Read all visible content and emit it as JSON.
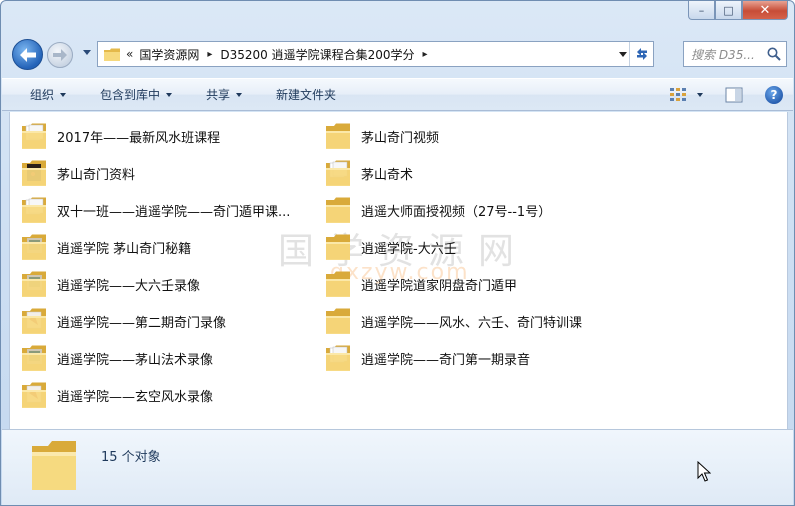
{
  "window": {
    "buttons": {
      "minimize": "–",
      "maximize": "□",
      "close": "✕"
    }
  },
  "address": {
    "overflow": "«",
    "crumbs": [
      "国学资源网",
      "D35200 逍遥学院课程合集200学分"
    ],
    "separator": "▸"
  },
  "search": {
    "placeholder": "搜索 D35..."
  },
  "toolbar": {
    "organize": "组织",
    "include_in_library": "包含到库中",
    "share": "共享",
    "new_folder": "新建文件夹"
  },
  "files": {
    "left": [
      {
        "name": "2017年——最新风水班课程",
        "icon": "folder-docs-icon"
      },
      {
        "name": "茅山奇门资料",
        "icon": "folder-dark-image-icon"
      },
      {
        "name": "双十一班——逍遥学院——奇门遁甲课...",
        "icon": "folder-docs-icon"
      },
      {
        "name": "逍遥学院 茅山奇门秘籍",
        "icon": "folder-image-icon"
      },
      {
        "name": "逍遥学院——大六壬录像",
        "icon": "folder-image-icon"
      },
      {
        "name": "逍遥学院——第二期奇门录像",
        "icon": "folder-red-icon"
      },
      {
        "name": "逍遥学院——茅山法术录像",
        "icon": "folder-image-icon"
      },
      {
        "name": "逍遥学院——玄空风水录像",
        "icon": "folder-red-icon"
      }
    ],
    "right": [
      {
        "name": "茅山奇门视频",
        "icon": "folder-icon"
      },
      {
        "name": "茅山奇术",
        "icon": "folder-docs-icon"
      },
      {
        "name": "逍遥大师面授视频（27号--1号）",
        "icon": "folder-icon"
      },
      {
        "name": "逍遥学院-大六壬",
        "icon": "folder-icon"
      },
      {
        "name": "逍遥学院道家阴盘奇门遁甲",
        "icon": "folder-icon"
      },
      {
        "name": "逍遥学院——风水、六壬、奇门特训课",
        "icon": "folder-icon"
      },
      {
        "name": "逍遥学院——奇门第一期录音",
        "icon": "folder-docs-icon"
      }
    ]
  },
  "watermark": {
    "text": "国学资源网",
    "sub": "gxzyw.com"
  },
  "details": {
    "count": "15 个对象"
  },
  "colors": {
    "folder": "#f4d47a",
    "folder_dark": "#d9aa3a",
    "accent": "#1e395b"
  }
}
